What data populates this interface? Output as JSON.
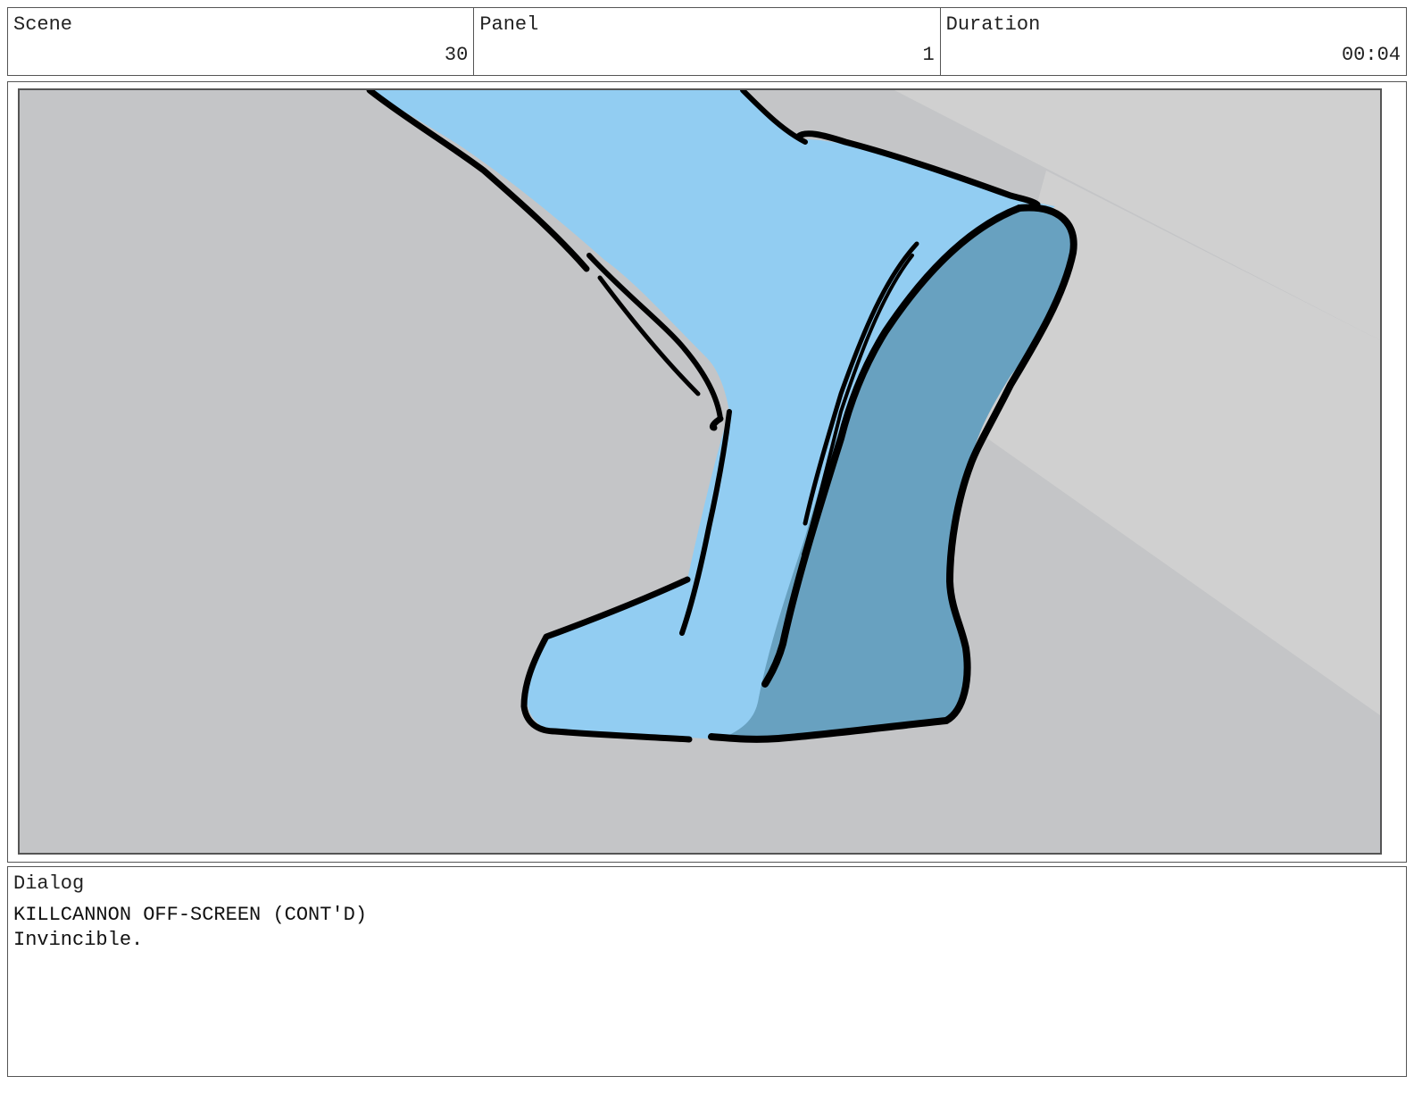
{
  "header": {
    "scene": {
      "label": "Scene",
      "value": "30"
    },
    "panel": {
      "label": "Panel",
      "value": "1"
    },
    "duration": {
      "label": "Duration",
      "value": "00:04"
    }
  },
  "frame": {
    "colors": {
      "background": "#c4c5c7",
      "light_beam": "#d0d0d0",
      "leg_light": "#92cdf2",
      "leg_shadow": "#68a1c0",
      "ink": "#000000"
    }
  },
  "dialog": {
    "label": "Dialog",
    "character": "KILLCANNON OFF-SCREEN (CONT'D)",
    "line": "Invincible."
  }
}
